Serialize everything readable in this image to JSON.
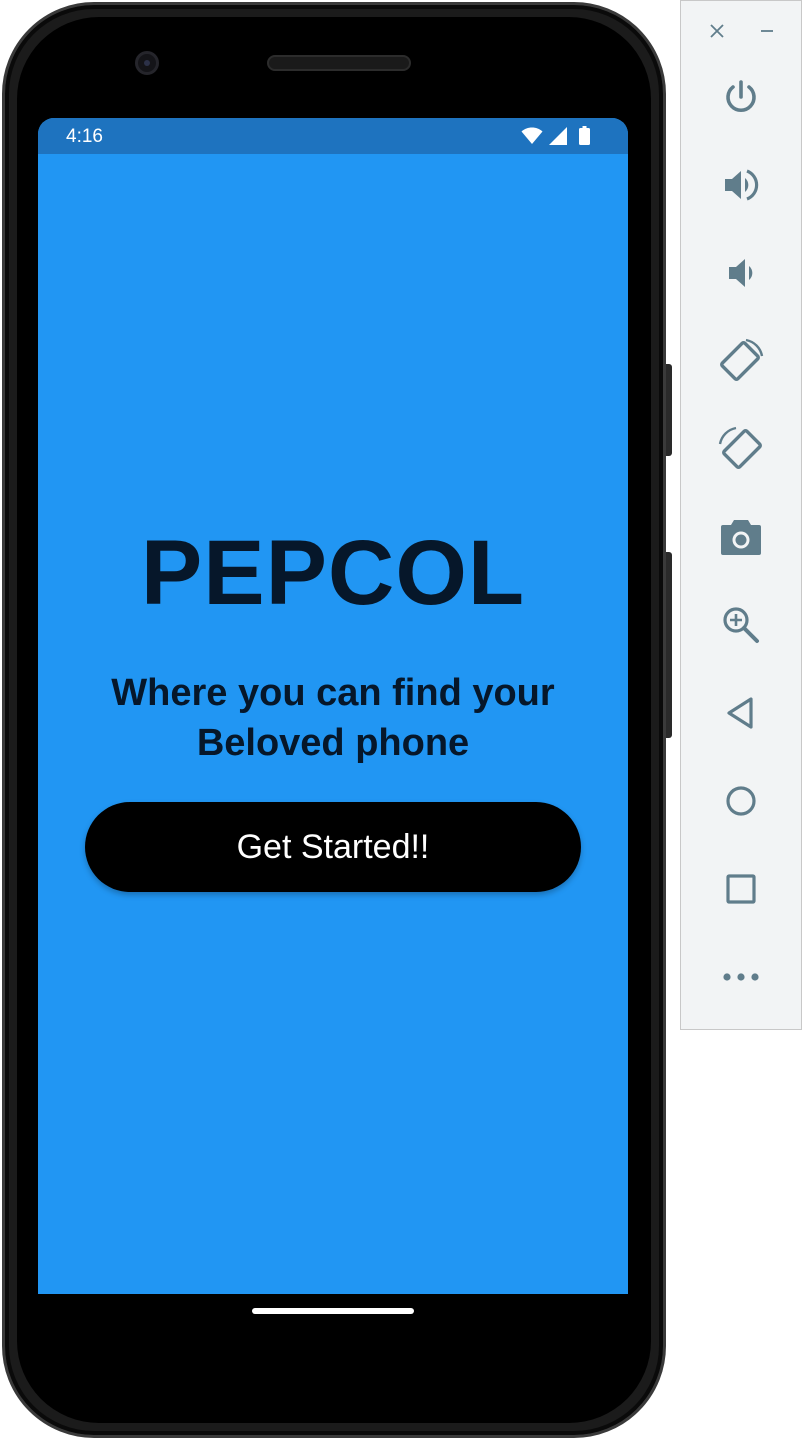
{
  "status_bar": {
    "time": "4:16",
    "icons": [
      "wifi-icon",
      "cell-signal-icon",
      "battery-icon"
    ]
  },
  "app": {
    "title": "PEPCOL",
    "tagline_line1": "Where you can find your",
    "tagline_line2": "Beloved phone",
    "cta_label": "Get Started!!"
  },
  "colors": {
    "screen_background": "#2196f3",
    "status_bar": "#1e73bf",
    "text_dark": "#06172a",
    "button": "#000000",
    "button_text": "#ffffff",
    "toolbar_icon": "#607d8b"
  },
  "emulator_toolbar": {
    "window_controls": [
      "close-icon",
      "minimize-icon"
    ],
    "buttons": [
      "power-icon",
      "volume-up-icon",
      "volume-down-icon",
      "rotate-left-icon",
      "rotate-right-icon",
      "camera-icon",
      "zoom-icon",
      "back-icon",
      "home-icon",
      "overview-icon",
      "more-icon"
    ]
  }
}
